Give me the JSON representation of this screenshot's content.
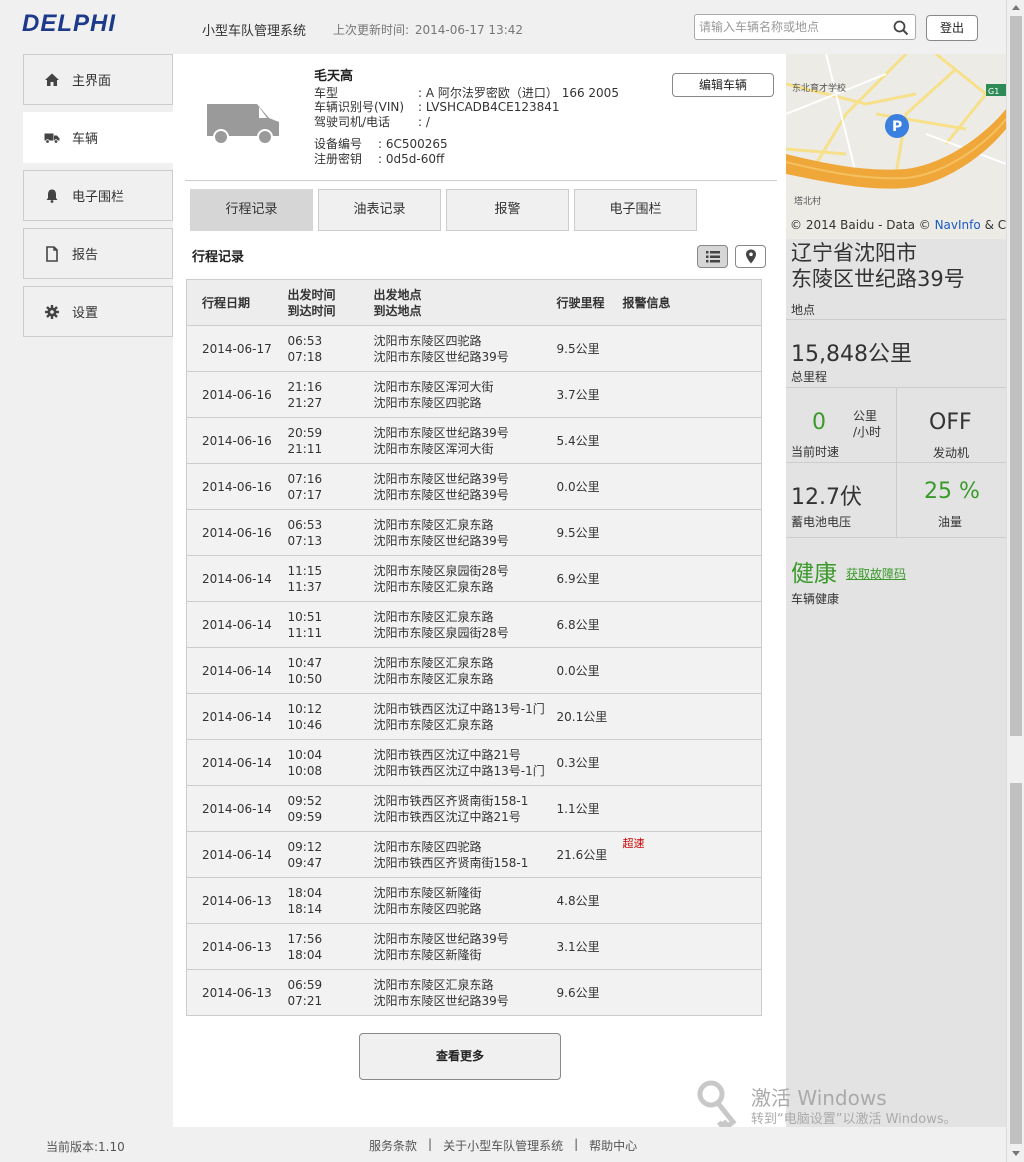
{
  "header": {
    "logo": "DELPHI",
    "app_title": "小型车队管理系统",
    "updated_label": "上次更新时间:",
    "updated_time": "2014-06-17 13:42",
    "search_placeholder": "请输入车辆名称或地点",
    "logout_label": "登出"
  },
  "sidebar": {
    "items": [
      {
        "label": "主界面",
        "icon": "home-icon"
      },
      {
        "label": "车辆",
        "icon": "truck-icon",
        "active": true
      },
      {
        "label": "电子围栏",
        "icon": "bell-icon"
      },
      {
        "label": "报告",
        "icon": "document-icon"
      },
      {
        "label": "设置",
        "icon": "gear-icon"
      }
    ]
  },
  "vehicle": {
    "name": "毛天高",
    "model_label": "车型",
    "model_value": ": A 阿尔法罗密欧（进口） 166 2005",
    "vin_label": "车辆识别号(VIN)",
    "vin_value": ": LVSHCADB4CE123841",
    "driver_label": "驾驶司机/电话",
    "driver_value": ": /",
    "device_label": "设备编号",
    "device_value": ": 6C500265",
    "key_label": "注册密钥",
    "key_value": ": 0d5d-60ff",
    "edit_label": "编辑车辆"
  },
  "tabs": [
    {
      "label": "行程记录",
      "active": true
    },
    {
      "label": "油表记录"
    },
    {
      "label": "报警"
    },
    {
      "label": "电子围栏"
    }
  ],
  "trips": {
    "title": "行程记录",
    "headers": {
      "date": "行程日期",
      "depart_time": "出发时间",
      "arrive_time": "到达时间",
      "depart_place": "出发地点",
      "arrive_place": "到达地点",
      "distance": "行驶里程",
      "alert": "报警信息"
    },
    "rows": [
      {
        "date": "2014-06-17",
        "t1": "06:53",
        "t2": "07:18",
        "p1": "沈阳市东陵区四驼路",
        "p2": "沈阳市东陵区世纪路39号",
        "dist": "9.5公里",
        "alert": ""
      },
      {
        "date": "2014-06-16",
        "t1": "21:16",
        "t2": "21:27",
        "p1": "沈阳市东陵区浑河大街",
        "p2": "沈阳市东陵区四驼路",
        "dist": "3.7公里",
        "alert": ""
      },
      {
        "date": "2014-06-16",
        "t1": "20:59",
        "t2": "21:11",
        "p1": "沈阳市东陵区世纪路39号",
        "p2": "沈阳市东陵区浑河大街",
        "dist": "5.4公里",
        "alert": ""
      },
      {
        "date": "2014-06-16",
        "t1": "07:16",
        "t2": "07:17",
        "p1": "沈阳市东陵区世纪路39号",
        "p2": "沈阳市东陵区世纪路39号",
        "dist": "0.0公里",
        "alert": ""
      },
      {
        "date": "2014-06-16",
        "t1": "06:53",
        "t2": "07:13",
        "p1": "沈阳市东陵区汇泉东路",
        "p2": "沈阳市东陵区世纪路39号",
        "dist": "9.5公里",
        "alert": ""
      },
      {
        "date": "2014-06-14",
        "t1": "11:15",
        "t2": "11:37",
        "p1": "沈阳市东陵区泉园街28号",
        "p2": "沈阳市东陵区汇泉东路",
        "dist": "6.9公里",
        "alert": ""
      },
      {
        "date": "2014-06-14",
        "t1": "10:51",
        "t2": "11:11",
        "p1": "沈阳市东陵区汇泉东路",
        "p2": "沈阳市东陵区泉园街28号",
        "dist": "6.8公里",
        "alert": ""
      },
      {
        "date": "2014-06-14",
        "t1": "10:47",
        "t2": "10:50",
        "p1": "沈阳市东陵区汇泉东路",
        "p2": "沈阳市东陵区汇泉东路",
        "dist": "0.0公里",
        "alert": ""
      },
      {
        "date": "2014-06-14",
        "t1": "10:12",
        "t2": "10:46",
        "p1": "沈阳市铁西区沈辽中路13号-1门",
        "p2": "沈阳市东陵区汇泉东路",
        "dist": "20.1公里",
        "alert": ""
      },
      {
        "date": "2014-06-14",
        "t1": "10:04",
        "t2": "10:08",
        "p1": "沈阳市铁西区沈辽中路21号",
        "p2": "沈阳市铁西区沈辽中路13号-1门",
        "dist": "0.3公里",
        "alert": ""
      },
      {
        "date": "2014-06-14",
        "t1": "09:52",
        "t2": "09:59",
        "p1": "沈阳市铁西区齐贤南街158-1",
        "p2": "沈阳市铁西区沈辽中路21号",
        "dist": "1.1公里",
        "alert": ""
      },
      {
        "date": "2014-06-14",
        "t1": "09:12",
        "t2": "09:47",
        "p1": "沈阳市东陵区四驼路",
        "p2": "沈阳市铁西区齐贤南街158-1",
        "dist": "21.6公里",
        "alert": "超速"
      },
      {
        "date": "2014-06-13",
        "t1": "18:04",
        "t2": "18:14",
        "p1": "沈阳市东陵区新隆街",
        "p2": "沈阳市东陵区四驼路",
        "dist": "4.8公里",
        "alert": ""
      },
      {
        "date": "2014-06-13",
        "t1": "17:56",
        "t2": "18:04",
        "p1": "沈阳市东陵区世纪路39号",
        "p2": "沈阳市东陵区新隆街",
        "dist": "3.1公里",
        "alert": ""
      },
      {
        "date": "2014-06-13",
        "t1": "06:59",
        "t2": "07:21",
        "p1": "沈阳市东陵区汇泉东路",
        "p2": "沈阳市东陵区世纪路39号",
        "dist": "9.6公里",
        "alert": ""
      }
    ],
    "more_label": "查看更多"
  },
  "map": {
    "labels": [
      "东北育才学校",
      "塔北村",
      "G1"
    ],
    "copyright_prefix": "© 2014 Baidu - Data ©",
    "copyright_link": "NavInfo",
    "copyright_suffix": "& Ce"
  },
  "status": {
    "address_line1": "辽宁省沈阳市",
    "address_line2": "东陵区世纪路39号",
    "address_label": "地点",
    "mileage": "15,848公里",
    "mileage_label": "总里程",
    "speed": "0",
    "speed_unit_line1": "公里",
    "speed_unit_line2": "/小时",
    "speed_label": "当前时速",
    "engine": "OFF",
    "engine_label": "发动机",
    "battery": "12.7伏",
    "battery_label": "蓄电池电压",
    "fuel": "25 %",
    "fuel_label": "油量",
    "health": "健康",
    "fault_link": "获取故障码",
    "health_label": "车辆健康"
  },
  "watermark": {
    "line1": "激活 Windows",
    "line2": "转到“电脑设置”以激活 Windows。"
  },
  "footer": {
    "version": "当前版本:1.10",
    "links": [
      "服务条款",
      "关于小型车队管理系统",
      "帮助中心"
    ],
    "separator": "|"
  }
}
